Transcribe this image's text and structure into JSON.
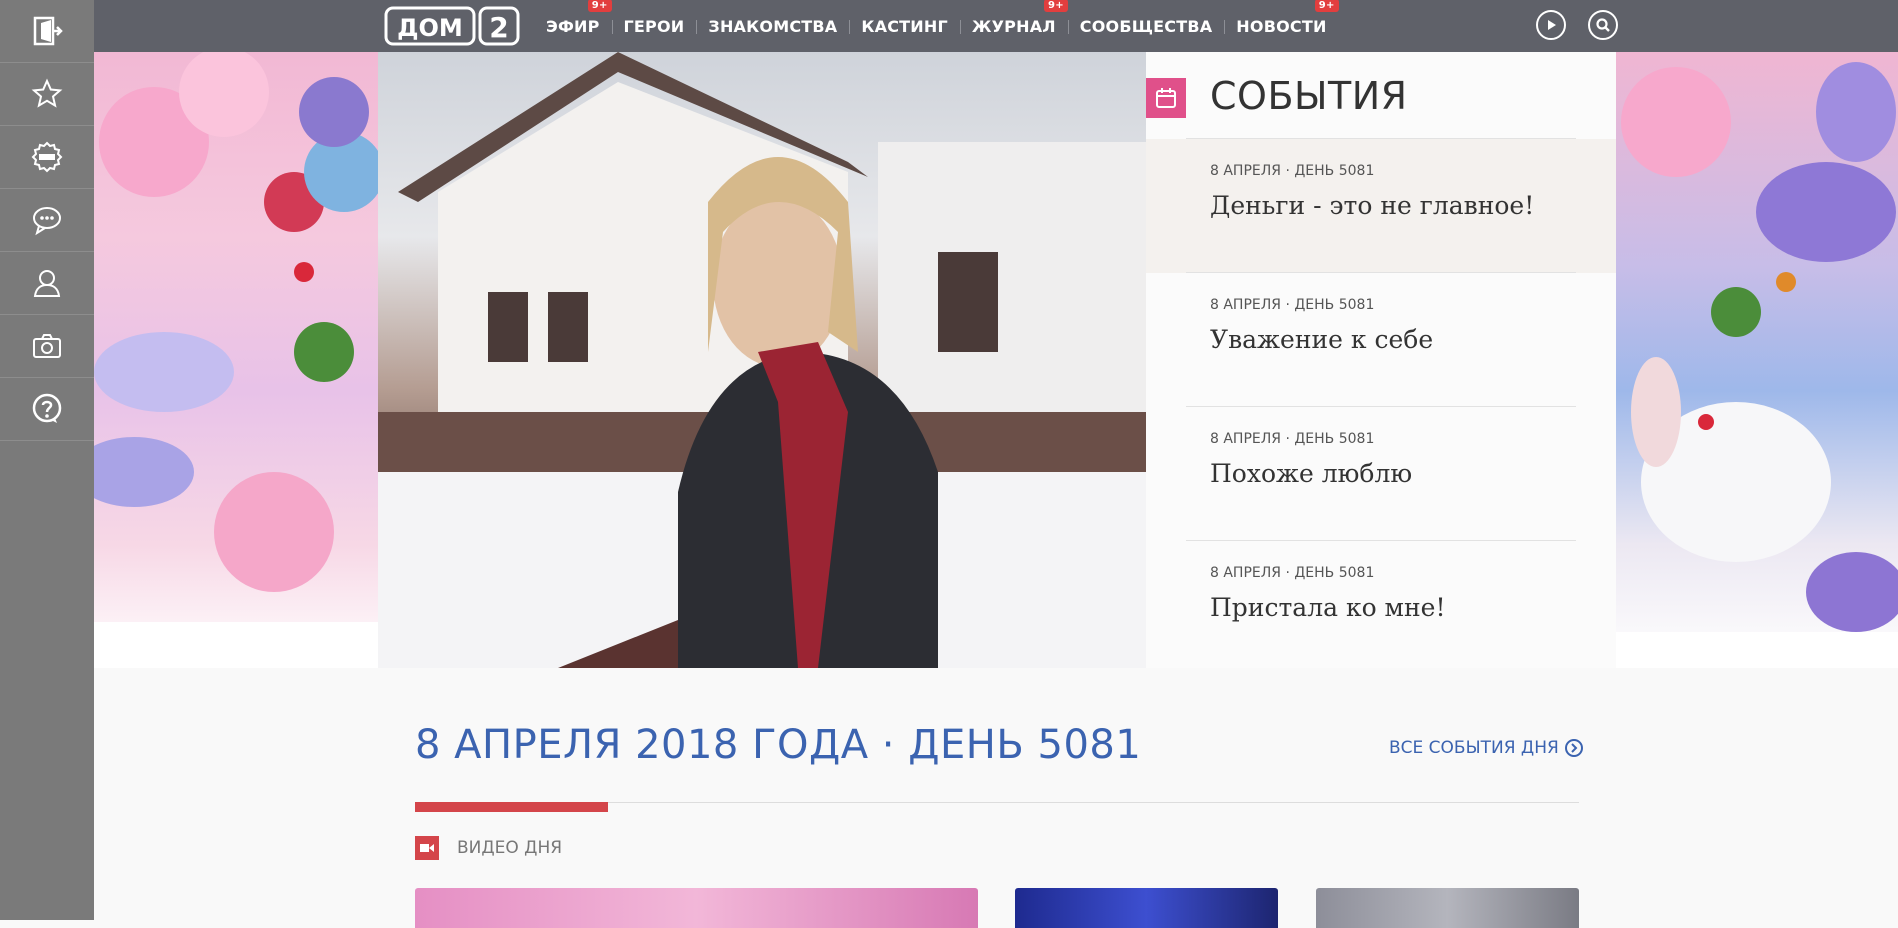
{
  "logo": {
    "text": "ДОМ",
    "number": "2"
  },
  "nav": [
    {
      "label": "ЭФИР",
      "badge": "9+"
    },
    {
      "label": "ГЕРОИ",
      "badge": ""
    },
    {
      "label": "ЗНАКОМСТВА",
      "badge": ""
    },
    {
      "label": "КАСТИНГ",
      "badge": ""
    },
    {
      "label": "ЖУРНАЛ",
      "badge": "9+"
    },
    {
      "label": "СООБЩЕСТВА",
      "badge": ""
    },
    {
      "label": "НОВОСТИ",
      "badge": "9+"
    }
  ],
  "sidebar": {
    "icons": [
      "login-icon",
      "star-icon",
      "news-icon",
      "chat-icon",
      "user-icon",
      "camera-icon",
      "help-icon"
    ]
  },
  "events": {
    "title": "СОБЫТИЯ",
    "items": [
      {
        "meta": "8 АПРЕЛЯ · ДЕНЬ 5081",
        "title": "Деньги - это не главное!",
        "active": true
      },
      {
        "meta": "8 АПРЕЛЯ · ДЕНЬ 5081",
        "title": "Уважение к себе",
        "active": false
      },
      {
        "meta": "8 АПРЕЛЯ · ДЕНЬ 5081",
        "title": "Похоже люблю",
        "active": false
      },
      {
        "meta": "8 АПРЕЛЯ · ДЕНЬ 5081",
        "title": "Пристала ко мне!",
        "active": false
      }
    ]
  },
  "day": {
    "title": "8 АПРЕЛЯ 2018 ГОДА · ДЕНЬ 5081",
    "all_events_link": "ВСЕ СОБЫТИЯ ДНЯ",
    "progress_fraction": 0.166
  },
  "video": {
    "label": "ВИДЕО ДНЯ"
  },
  "colors": {
    "topbar": "#5f6169",
    "sidebar": "#7a7a7a",
    "accent_blue": "#3b63b0",
    "accent_red": "#d4454a",
    "accent_pink": "#e0508a",
    "badge_red": "#e23e3e"
  }
}
